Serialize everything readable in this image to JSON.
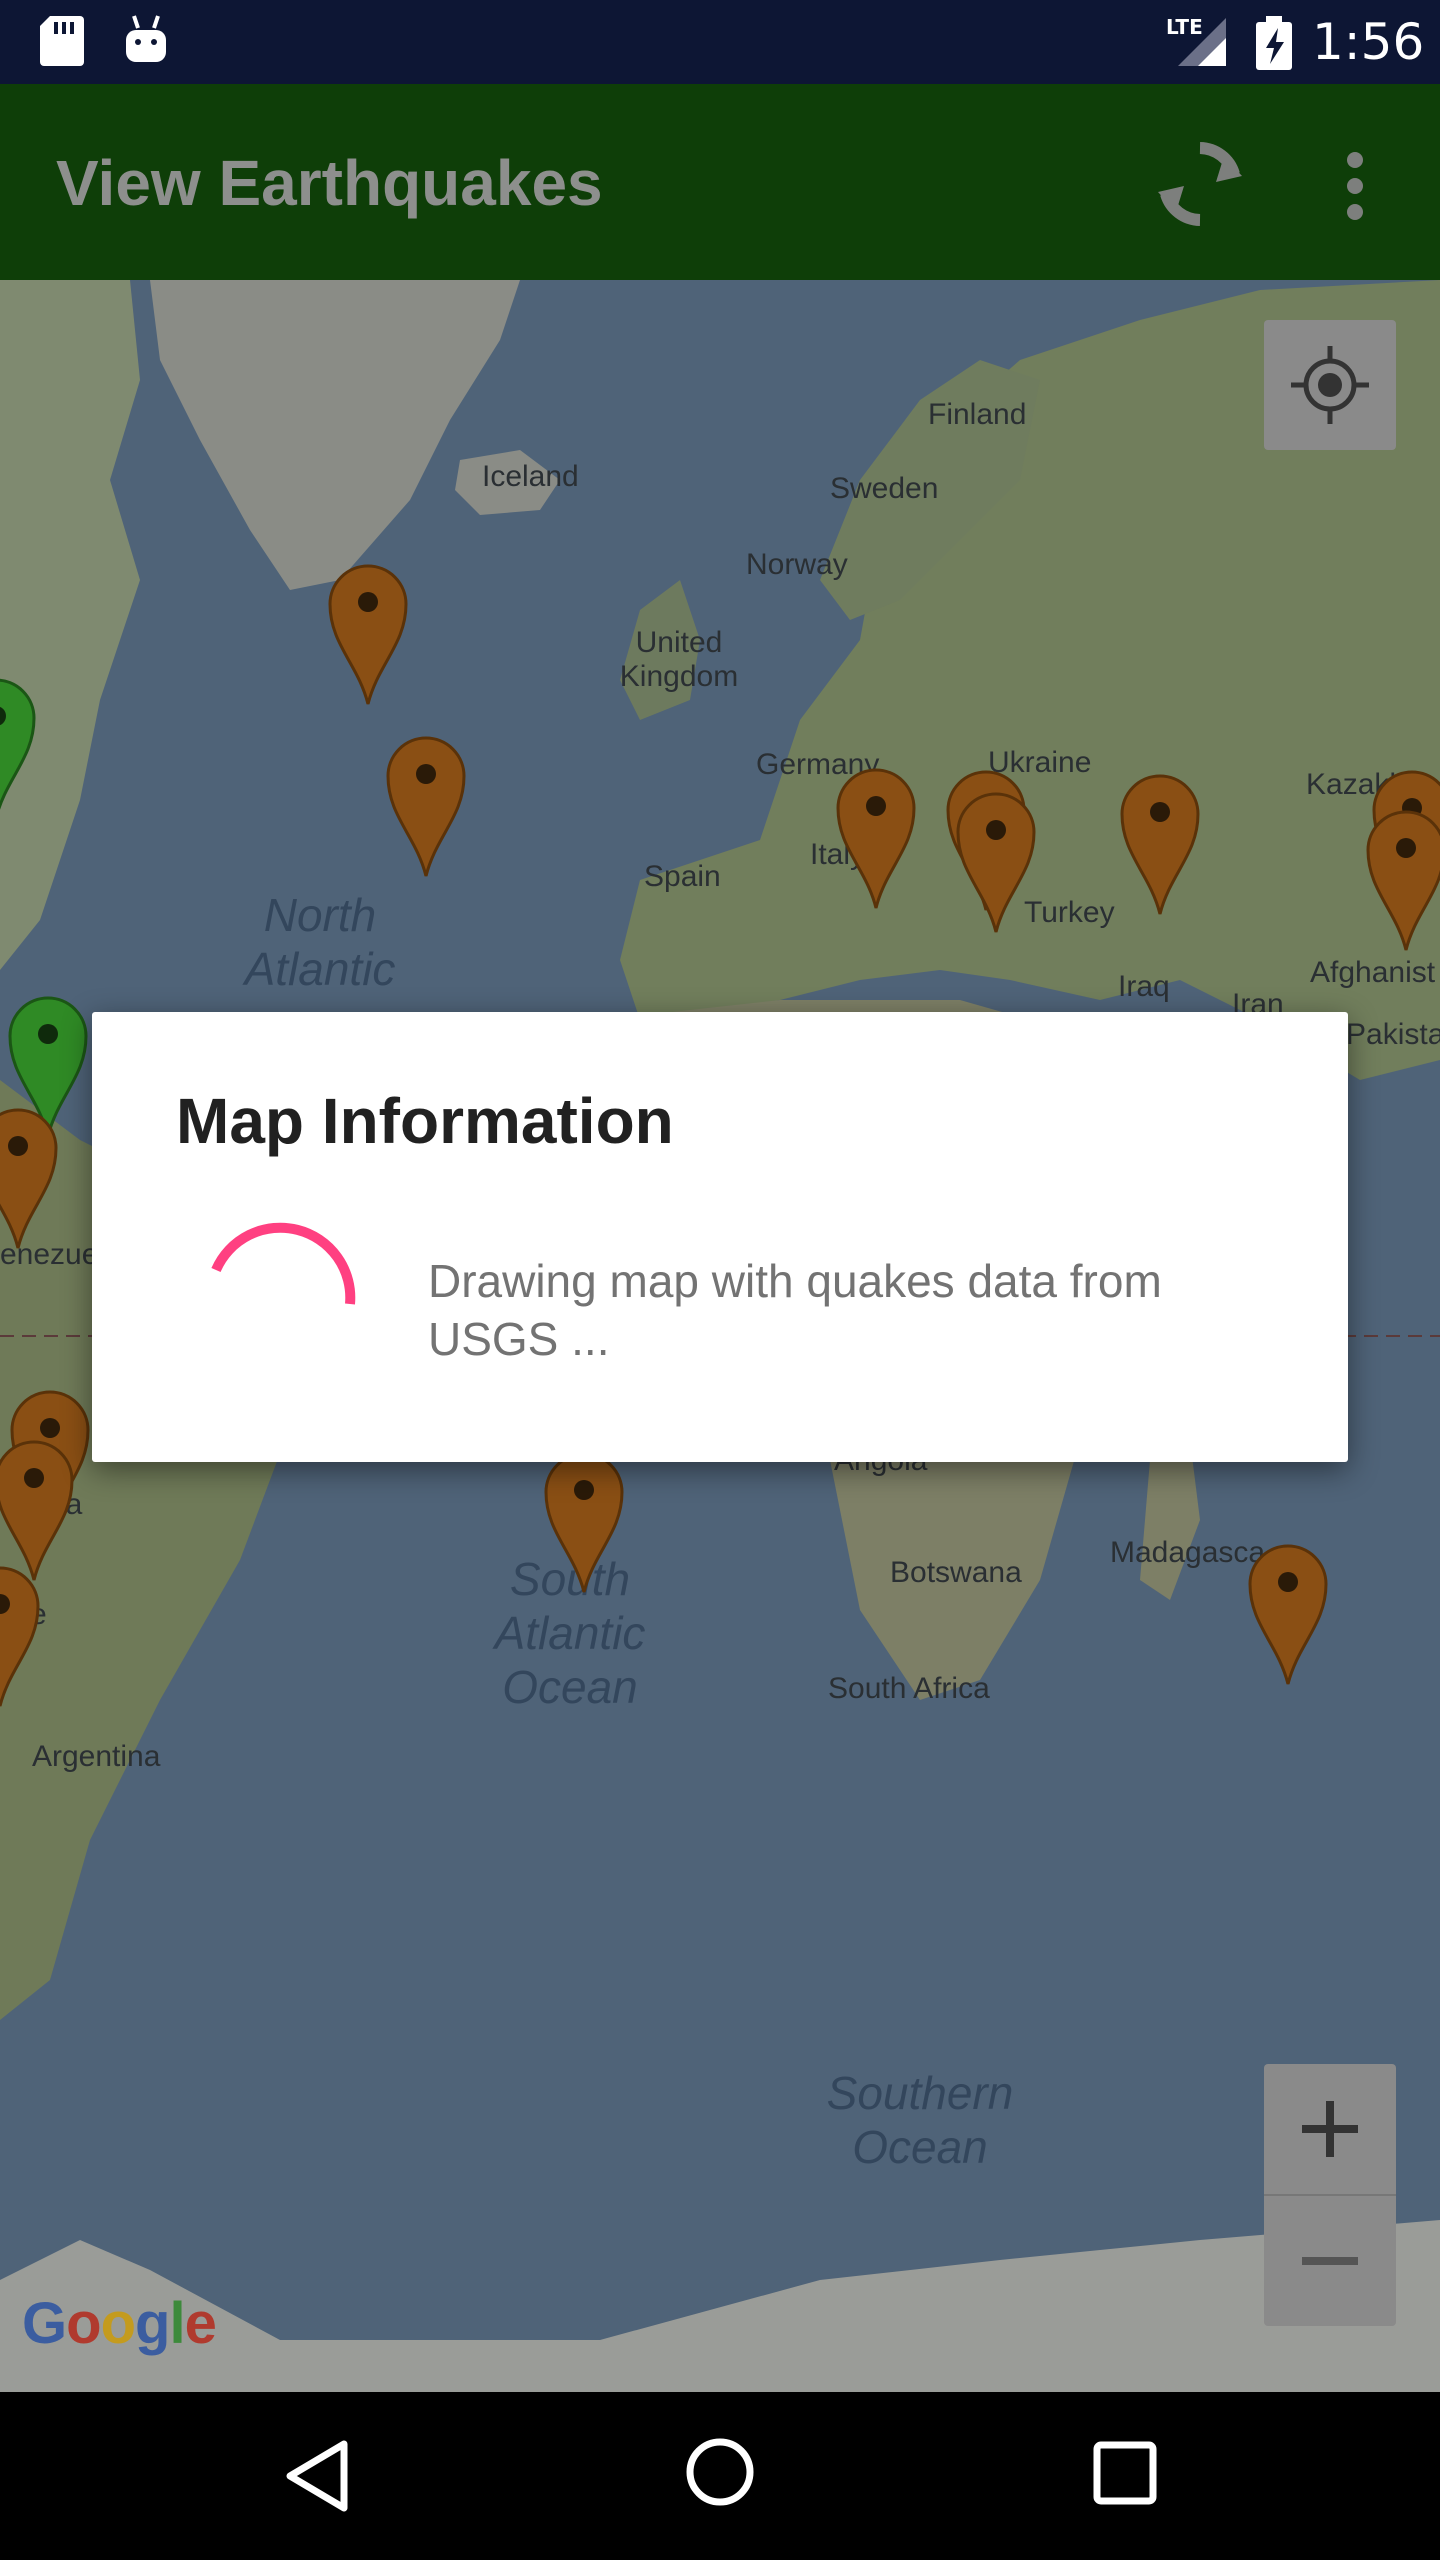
{
  "status_bar": {
    "network": "LTE",
    "time": "1:56",
    "icons": [
      "sd-card-icon",
      "android-debug-icon",
      "lte-signal-icon",
      "battery-charging-icon"
    ]
  },
  "app_bar": {
    "title": "View Earthquakes",
    "refresh_icon": "refresh-icon",
    "overflow_icon": "more-vert-icon",
    "color": "#0e3e08"
  },
  "map": {
    "labels": {
      "finland": "Finland",
      "sweden": "Sweden",
      "norway": "Norway",
      "iceland": "Iceland",
      "uk": "United Kingdom",
      "germany": "Germany",
      "ukraine": "Ukraine",
      "kazakh": "Kazakh",
      "italy": "Italy",
      "spain": "Spain",
      "turkey": "Turkey",
      "iraq": "Iraq",
      "iran": "Iran",
      "afghanist": "Afghanist",
      "pakista": "Pakista",
      "venezue": "enezue",
      "bolivia": "via",
      "chile": "e",
      "argentina": "Argentina",
      "angola": "Angola",
      "botswana": "Botswana",
      "madagascar": "Madagasca",
      "south_africa": "South Africa"
    },
    "oceans": {
      "north_atlantic": "North Atlantic",
      "south_atlantic": "South Atlantic Ocean",
      "southern": "Southern Ocean"
    },
    "controls": {
      "my_location_icon": "my-location-icon",
      "zoom_in": "+",
      "zoom_out": "−"
    },
    "attribution": "Google",
    "pin_colors": {
      "brown": "#8a4f14",
      "green": "#2f8a25"
    }
  },
  "dialog": {
    "title": "Map Information",
    "message": "Drawing map with quakes data from USGS ...",
    "spinner_color": "#ff4081"
  },
  "nav_bar": {
    "back_icon": "back-icon",
    "home_icon": "home-icon",
    "recents_icon": "recents-icon"
  }
}
